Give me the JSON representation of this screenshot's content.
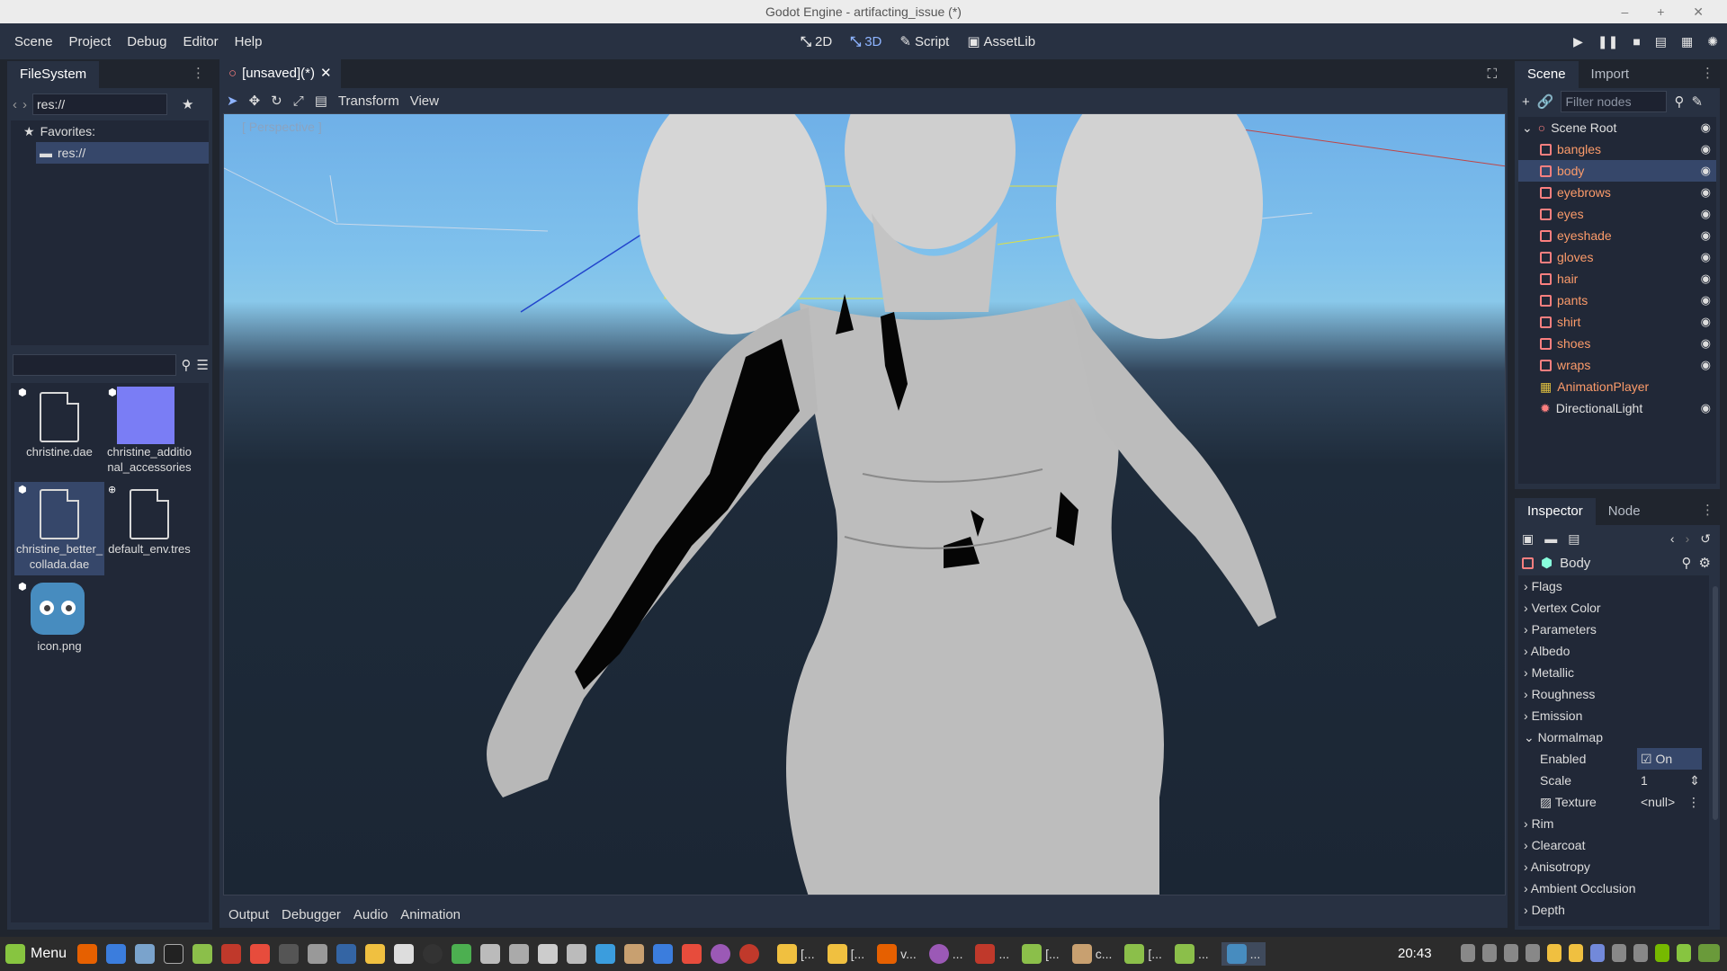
{
  "window": {
    "title": "Godot Engine - artifacting_issue (*)"
  },
  "menubar": {
    "menus": [
      "Scene",
      "Project",
      "Debug",
      "Editor",
      "Help"
    ],
    "workspaces": {
      "2d": "2D",
      "3d": "3D",
      "script": "Script",
      "assetlib": "AssetLib"
    }
  },
  "filesystem": {
    "tab": "FileSystem",
    "path": "res://",
    "favorites": "Favorites:",
    "root": "res://",
    "files": [
      {
        "name": "christine.dae"
      },
      {
        "name": "christine_additional_accessories"
      },
      {
        "name": "christine_better_collada.dae"
      },
      {
        "name": "default_env.tres"
      },
      {
        "name": "icon.png"
      }
    ]
  },
  "viewport": {
    "tab": "[unsaved](*)",
    "menu_transform": "Transform",
    "menu_view": "View",
    "perspective": "[ Perspective ]"
  },
  "bottom_tabs": [
    "Output",
    "Debugger",
    "Audio",
    "Animation"
  ],
  "scene_dock": {
    "tabs": [
      "Scene",
      "Import"
    ],
    "filter_placeholder": "Filter nodes",
    "root": "Scene Root",
    "nodes": [
      "bangles",
      "body",
      "eyebrows",
      "eyes",
      "eyeshade",
      "gloves",
      "hair",
      "pants",
      "shirt",
      "shoes",
      "wraps",
      "AnimationPlayer",
      "DirectionalLight"
    ],
    "selected": "body"
  },
  "inspector": {
    "tabs": [
      "Inspector",
      "Node"
    ],
    "resource": "Body",
    "sections_top": [
      "Flags",
      "Vertex Color",
      "Parameters",
      "Albedo",
      "Metallic",
      "Roughness",
      "Emission",
      "Normalmap"
    ],
    "normalmap": {
      "enabled_label": "Enabled",
      "enabled_value": "On",
      "scale_label": "Scale",
      "scale_value": "1",
      "texture_label": "Texture",
      "texture_value": "<null>"
    },
    "sections_bottom": [
      "Rim",
      "Clearcoat",
      "Anisotropy",
      "Ambient Occlusion",
      "Depth"
    ]
  },
  "taskbar": {
    "menu": "Menu",
    "windows": [
      "[...",
      "[...",
      "v...",
      "...",
      "...",
      "[...",
      "c...",
      "[...",
      "...",
      "..."
    ],
    "clock": "20:43"
  },
  "colors": {
    "accent": "#8eb4ff",
    "panel": "#283142",
    "node_orange": "#fc9b6a",
    "mesh_icon": "#fc7f7f"
  }
}
